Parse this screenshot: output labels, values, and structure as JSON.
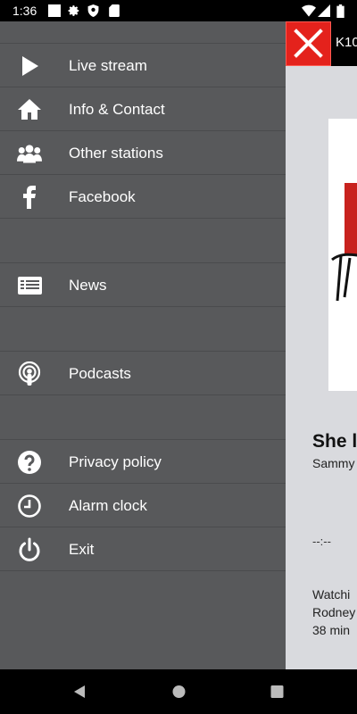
{
  "status_bar": {
    "time": "1:36",
    "icons": [
      "image-icon",
      "settings-icon",
      "shield-icon",
      "sd-card-icon",
      "wifi-icon",
      "signal-icon",
      "battery-icon"
    ]
  },
  "background_app": {
    "title_fragment": "K10",
    "song_title": "She l",
    "song_artist": "Sammy",
    "time_display": "--:--",
    "news_lines": [
      "Watchi",
      "Rodney",
      "38 min"
    ],
    "colors": {
      "close_button": "#e4221c",
      "app_background": "#d9dade"
    }
  },
  "drawer": {
    "background_color": "#58595b",
    "items": [
      {
        "label": "Live stream",
        "icon": "play-icon"
      },
      {
        "label": "Info & Contact",
        "icon": "home-icon"
      },
      {
        "label": "Other stations",
        "icon": "group-icon"
      },
      {
        "label": "Facebook",
        "icon": "facebook-icon"
      },
      {
        "label": "News",
        "icon": "news-icon"
      },
      {
        "label": "Podcasts",
        "icon": "podcast-icon"
      },
      {
        "label": "Privacy policy",
        "icon": "help-icon"
      },
      {
        "label": "Alarm clock",
        "icon": "clock-icon"
      },
      {
        "label": "Exit",
        "icon": "power-icon"
      }
    ]
  },
  "nav_bar": {
    "buttons": [
      "back-icon",
      "home-circle-icon",
      "recents-icon"
    ]
  }
}
